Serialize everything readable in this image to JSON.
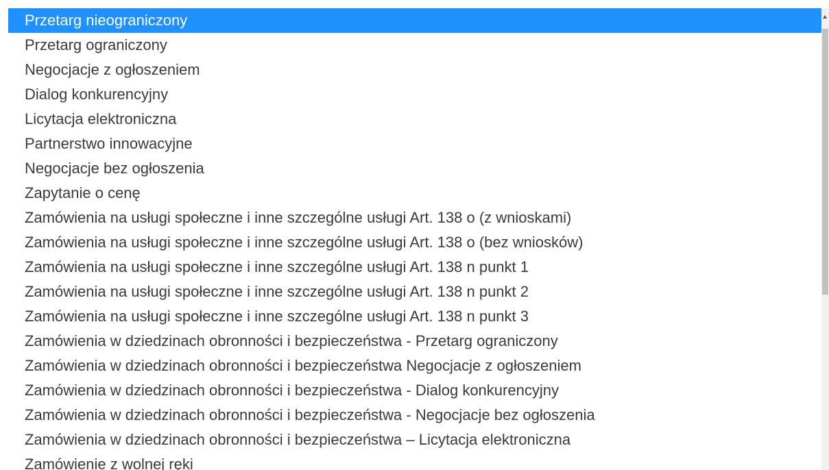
{
  "listbox": {
    "selected_index": 0,
    "options": [
      {
        "label": "Przetarg nieograniczony"
      },
      {
        "label": "Przetarg ograniczony"
      },
      {
        "label": "Negocjacje z ogłoszeniem"
      },
      {
        "label": "Dialog konkurencyjny"
      },
      {
        "label": "Licytacja elektroniczna"
      },
      {
        "label": "Partnerstwo innowacyjne"
      },
      {
        "label": "Negocjacje bez ogłoszenia"
      },
      {
        "label": "Zapytanie o cenę"
      },
      {
        "label": "Zamówienia na usługi społeczne i inne szczególne usługi Art. 138 o (z wnioskami)"
      },
      {
        "label": "Zamówienia na usługi społeczne i inne szczególne usługi Art. 138 o (bez wniosków)"
      },
      {
        "label": "Zamówienia na usługi społeczne i inne szczególne usługi Art. 138 n punkt 1"
      },
      {
        "label": "Zamówienia na usługi społeczne i inne szczególne usługi Art. 138 n punkt 2"
      },
      {
        "label": "Zamówienia na usługi społeczne i inne szczególne usługi Art. 138 n punkt 3"
      },
      {
        "label": "Zamówienia w dziedzinach obronności i bezpieczeństwa - Przetarg ograniczony"
      },
      {
        "label": "Zamówienia w dziedzinach obronności i bezpieczeństwa Negocjacje z ogłoszeniem"
      },
      {
        "label": "Zamówienia w dziedzinach obronności i bezpieczeństwa - Dialog konkurencyjny"
      },
      {
        "label": "Zamówienia w dziedzinach obronności i bezpieczeństwa - Negocjacje bez ogłoszenia"
      },
      {
        "label": "Zamówienia w dziedzinach obronności i bezpieczeństwa – Licytacja elektroniczna"
      },
      {
        "label": "Zamówienie z wolnej ręki"
      }
    ]
  },
  "scrollbar": {
    "up_icon": "chevron-up-icon"
  },
  "colors": {
    "selected_background": "#1e90ff",
    "selected_text": "#ffffff",
    "option_text": "#3a3a3a"
  }
}
